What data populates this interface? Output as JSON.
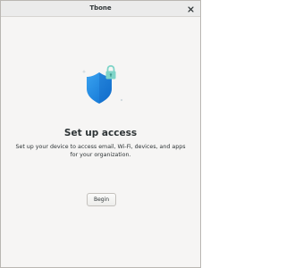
{
  "window": {
    "title": "Tbone"
  },
  "main": {
    "heading": "Set up access",
    "description": "Set up your device to access email, Wi-Fi, devices, and apps for your organization.",
    "begin_label": "Begin"
  },
  "icons": {
    "close": "close-icon",
    "hero": "shield-lock-icon"
  },
  "colors": {
    "window_bg": "#f6f5f4",
    "titlebar_bg": "#ebebeb",
    "text": "#2e3436",
    "shield_blue": "#1e88e5",
    "lock_teal": "#7fd4c8"
  }
}
